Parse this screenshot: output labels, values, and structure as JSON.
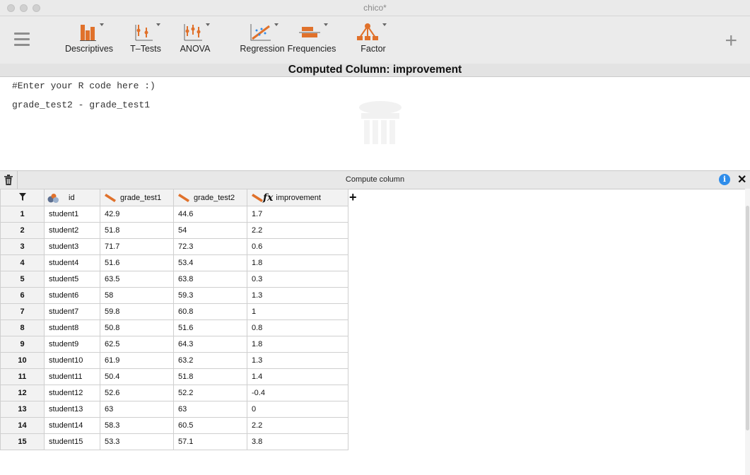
{
  "window": {
    "title": "chico*"
  },
  "toolbar": {
    "tools": [
      {
        "label": "Descriptives",
        "icon": "descriptives-icon"
      },
      {
        "label": "T–Tests",
        "icon": "t-tests-icon"
      },
      {
        "label": "ANOVA",
        "icon": "anova-icon"
      },
      {
        "label": "Regression",
        "icon": "regression-icon"
      },
      {
        "label": "Frequencies",
        "icon": "frequencies-icon"
      },
      {
        "label": "Factor",
        "icon": "factor-icon"
      }
    ],
    "add_icon": "plus-icon",
    "menu_icon": "hamburger-icon"
  },
  "computed": {
    "header": "Computed Column: improvement",
    "code_comment": "#Enter your R code here :)",
    "code": "grade_test2 - grade_test1",
    "compute_label": "Compute column",
    "info_glyph": "i",
    "close_glyph": "✕"
  },
  "table": {
    "columns": [
      "id",
      "grade_test1",
      "grade_test2",
      "improvement"
    ],
    "add_column_glyph": "+",
    "rows": [
      [
        "1",
        "student1",
        "42.9",
        "44.6",
        "1.7"
      ],
      [
        "2",
        "student2",
        "51.8",
        "54",
        "2.2"
      ],
      [
        "3",
        "student3",
        "71.7",
        "72.3",
        "0.6"
      ],
      [
        "4",
        "student4",
        "51.6",
        "53.4",
        "1.8"
      ],
      [
        "5",
        "student5",
        "63.5",
        "63.8",
        "0.3"
      ],
      [
        "6",
        "student6",
        "58",
        "59.3",
        "1.3"
      ],
      [
        "7",
        "student7",
        "59.8",
        "60.8",
        "1"
      ],
      [
        "8",
        "student8",
        "50.8",
        "51.6",
        "0.8"
      ],
      [
        "9",
        "student9",
        "62.5",
        "64.3",
        "1.8"
      ],
      [
        "10",
        "student10",
        "61.9",
        "63.2",
        "1.3"
      ],
      [
        "11",
        "student11",
        "50.4",
        "51.8",
        "1.4"
      ],
      [
        "12",
        "student12",
        "52.6",
        "52.2",
        "-0.4"
      ],
      [
        "13",
        "student13",
        "63",
        "63",
        "0"
      ],
      [
        "14",
        "student14",
        "58.3",
        "60.5",
        "2.2"
      ],
      [
        "15",
        "student15",
        "53.3",
        "57.1",
        "3.8"
      ]
    ]
  },
  "colors": {
    "accent": "#e0712b",
    "info": "#2f8dea"
  }
}
